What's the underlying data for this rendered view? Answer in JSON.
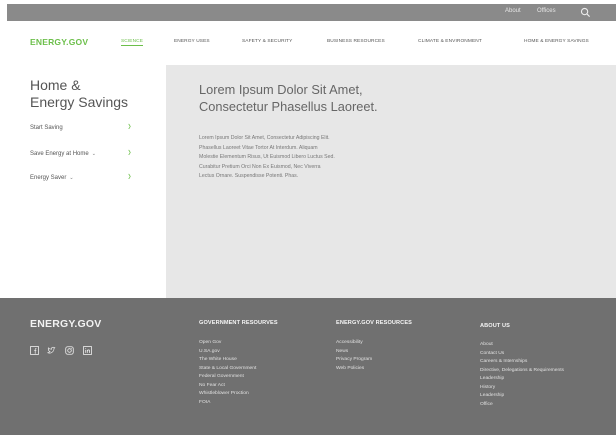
{
  "utility_bar": {
    "links": [
      "About",
      "Offices"
    ],
    "search_icon": "search-icon"
  },
  "brand": {
    "logo": "ENERGY.GOV",
    "accent_color": "#6cbf4a"
  },
  "nav": {
    "items": [
      "SCIENCE",
      "ENERGY USES",
      "SAFETY & SECURITY",
      "BUSINESS RESOURCES",
      "CLIMATE & ENVIRONMENT",
      "HOME & ENERGY SAVINGS"
    ],
    "active": "SCIENCE"
  },
  "sidebar": {
    "title_line1": "Home &",
    "title_line2": "Energy Savings",
    "items": [
      {
        "label": "Start Saving",
        "has_dropdown": false,
        "arrow_icon": "chevron-right-icon"
      },
      {
        "label": "Save Energy at Home",
        "has_dropdown": true,
        "arrow_icon": "chevron-right-icon"
      },
      {
        "label": "Energy Saver",
        "has_dropdown": true,
        "arrow_icon": "chevron-right-icon"
      }
    ]
  },
  "main": {
    "title": "Lorem Ipsum Dolor Sit Amet, Consectetur  Phasellus Laoreet.",
    "body_lines": [
      "Lorem Ipsum Dolor Sit Amet, Consectetur Adipiscing Elit.",
      "Phasellus Laoreet Vitae Tortor At Interdum. Aliquam",
      "Molestie Elementum Risus, Ut Euismod Libero Luctus Sed.",
      "Curabitur Pretium Orci Non Ex Euismod, Nec Viverra",
      "Lectus Ornare. Suspendisse Potenti. Phas."
    ]
  },
  "footer": {
    "logo": "ENERGY.GOV",
    "social_icons": [
      "facebook-icon",
      "twitter-icon",
      "instagram-icon",
      "linkedin-icon"
    ],
    "columns": [
      {
        "heading": "GOVERNMENT RESOURVES",
        "links": [
          "Open Gov",
          "U.SA.gov",
          "The White House",
          "State & Local Government",
          "Federal Government",
          "No Fear Act",
          "Whistleblower Proction",
          "FOIA"
        ]
      },
      {
        "heading": "ENERGY.GOV RESOURCES",
        "links": [
          "Accessibility",
          "News",
          "Privacy Program",
          "Web Policies"
        ]
      },
      {
        "heading": "ABOUT US",
        "links": [
          "About",
          "Contact Us",
          "Careers & Internships",
          "Directive, Delegations & Requirements",
          "Leadership",
          "History",
          "Leadership",
          "Office"
        ]
      }
    ]
  }
}
